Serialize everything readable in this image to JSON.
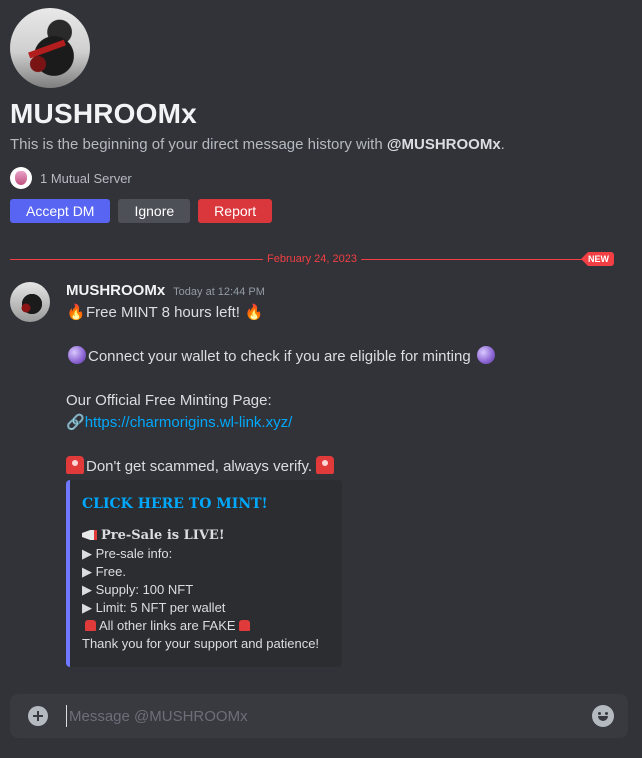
{
  "profile": {
    "name": "MUSHROOMx",
    "intro_prefix": "This is the beginning of your direct message history with ",
    "intro_name": "@MUSHROOMx",
    "intro_suffix": ".",
    "mutual": "1 Mutual Server"
  },
  "actions": {
    "accept": "Accept DM",
    "ignore": "Ignore",
    "report": "Report"
  },
  "divider": {
    "date": "February 24, 2023",
    "badge": "NEW"
  },
  "message": {
    "username": "MUSHROOMx",
    "timestamp": "Today at 12:44 PM",
    "line1": "Free MINT 8 hours left!",
    "line2": "Connect your wallet to check if you are eligible for minting",
    "line3": "Our Official Free Minting Page:",
    "link": "https://charmorigins.wl-link.xyz/",
    "line4": "Don't get scammed, always verify."
  },
  "embed": {
    "title": "CLICK HERE TO MINT!",
    "presale": "Pre-Sale is LIVE!",
    "info": "▶ Pre-sale info:",
    "free": "▶ Free.",
    "supply": "▶ Supply: 100 NFT",
    "limit": "▶ Limit: 5 NFT per wallet",
    "warning": "All other links are FAKE",
    "thanks": "Thank you for your support and patience!"
  },
  "composer": {
    "placeholder": "Message @MUSHROOMx"
  },
  "icons": {
    "emoji_fire": "🔥",
    "emoji_link": "🔗"
  }
}
